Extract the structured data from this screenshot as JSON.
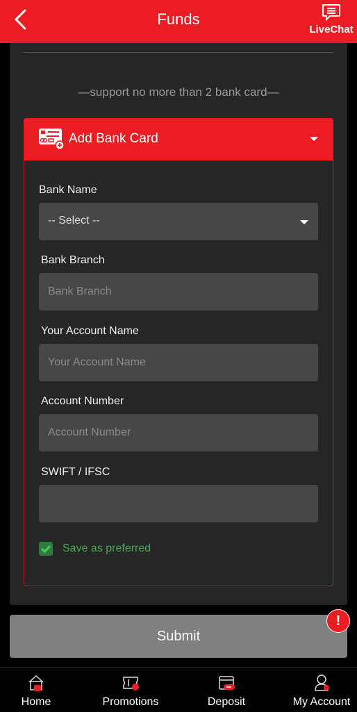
{
  "header": {
    "title": "Funds",
    "back_icon": "chevron-left-icon",
    "livechat_label": "LiveChat",
    "livechat_icon": "chat-bubble-icon"
  },
  "notice": "—support no more than 2 bank card—",
  "add_card": {
    "title": "Add Bank Card",
    "icon": "credit-card-plus-icon",
    "expanded": true,
    "fields": {
      "bank_name": {
        "label": "Bank Name",
        "value": "-- Select --"
      },
      "bank_branch": {
        "label": "Bank Branch",
        "placeholder": "Bank Branch",
        "value": ""
      },
      "account_name": {
        "label": "Your Account Name",
        "placeholder": "Your Account Name",
        "value": ""
      },
      "account_number": {
        "label": "Account Number",
        "placeholder": "Account Number",
        "value": ""
      },
      "swift": {
        "label": "SWIFT / IFSC",
        "placeholder": "",
        "value": ""
      }
    },
    "save_preferred": {
      "label": "Save as preferred",
      "checked": true
    }
  },
  "submit_label": "Submit",
  "alert_badge": "!",
  "bottom_nav": {
    "items": [
      {
        "label": "Home",
        "icon": "home-icon"
      },
      {
        "label": "Promotions",
        "icon": "ticket-icon"
      },
      {
        "label": "Deposit",
        "icon": "wallet-icon"
      },
      {
        "label": "My Account",
        "icon": "user-icon",
        "active": true
      }
    ]
  },
  "colors": {
    "brand_red": "#ec1c24",
    "panel_bg": "#262626",
    "input_bg": "#474747",
    "success_green": "#3fae52",
    "submit_disabled": "#808080"
  }
}
